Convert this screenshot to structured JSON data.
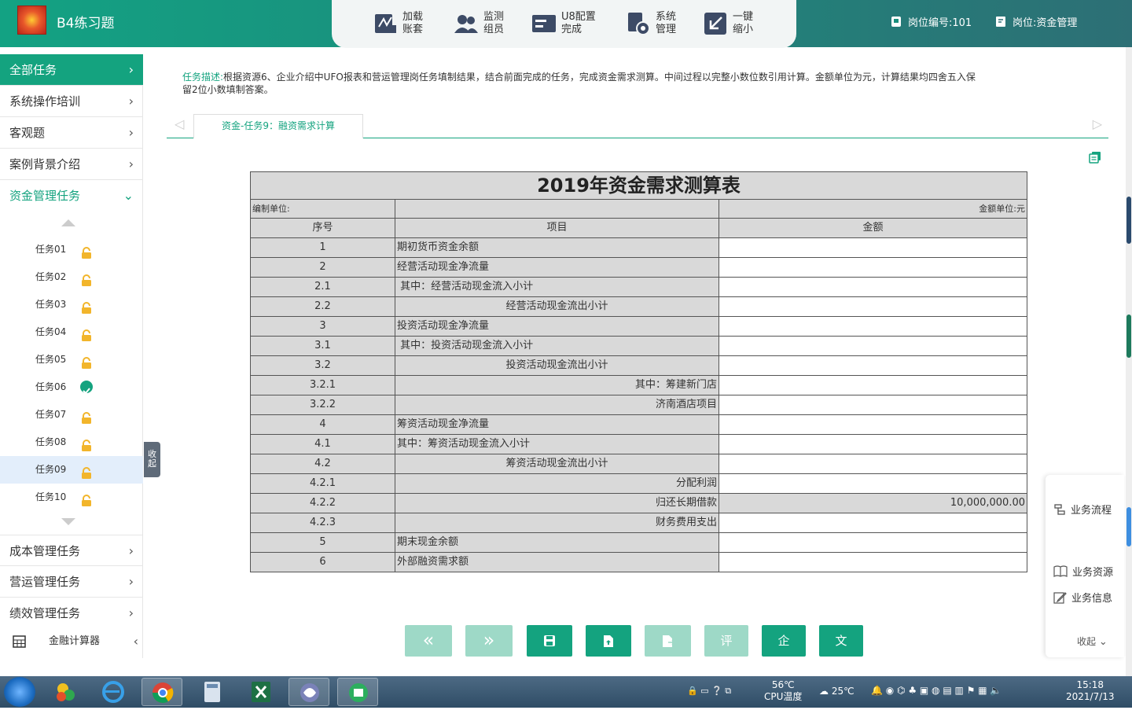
{
  "app": {
    "title": "B4练习题"
  },
  "toolbar": [
    {
      "label": "加载\n账套",
      "icon": "load-account-icon"
    },
    {
      "label": "监测\n组员",
      "icon": "monitor-members-icon"
    },
    {
      "label": "U8配置\n完成",
      "icon": "u8-config-icon"
    },
    {
      "label": "系统\n管理",
      "icon": "system-manage-icon"
    },
    {
      "label": "一键\n缩小",
      "icon": "minimize-icon"
    }
  ],
  "header": {
    "position_no": "岗位编号:101",
    "position_name": "岗位:资金管理"
  },
  "sidebar": {
    "menu": [
      {
        "label": "全部任务"
      },
      {
        "label": "系统操作培训"
      },
      {
        "label": "客观题"
      },
      {
        "label": "案例背景介绍"
      },
      {
        "label": "资金管理任务"
      }
    ],
    "tasks": [
      {
        "label": "任务01",
        "status": "locked"
      },
      {
        "label": "任务02",
        "status": "locked"
      },
      {
        "label": "任务03",
        "status": "locked"
      },
      {
        "label": "任务04",
        "status": "locked"
      },
      {
        "label": "任务05",
        "status": "locked"
      },
      {
        "label": "任务06",
        "status": "done"
      },
      {
        "label": "任务07",
        "status": "locked"
      },
      {
        "label": "任务08",
        "status": "locked"
      },
      {
        "label": "任务09",
        "status": "locked"
      },
      {
        "label": "任务10",
        "status": "locked"
      }
    ],
    "menu_bottom": [
      {
        "label": "成本管理任务"
      },
      {
        "label": "营运管理任务"
      },
      {
        "label": "绩效管理任务"
      }
    ],
    "calculator": "金融计算器",
    "collapse": "收起"
  },
  "task": {
    "desc_label": "任务描述:",
    "desc_text": "根据资源6、企业介绍中UFO报表和营运管理岗任务填制结果，结合前面完成的任务，完成资金需求测算。中间过程以完整小数位数引用计算。金额单位为元，计算结果均四舍五入保留2位小数填制答案。",
    "tab": "资金-任务9：融资需求计算"
  },
  "sheet": {
    "title": "2019年资金需求测算表",
    "unit_left": "编制单位:",
    "unit_right": "金额单位:元",
    "headers": [
      "序号",
      "项目",
      "金额"
    ],
    "rows": [
      {
        "no": "1",
        "item": "期初货币资金余额",
        "amount": ""
      },
      {
        "no": "2",
        "item": "经营活动现金净流量",
        "amount": ""
      },
      {
        "no": "2.1",
        "item": " 其中：经营活动现金流入小计",
        "amount": ""
      },
      {
        "no": "2.2",
        "item": "经营活动现金流出小计",
        "amount": ""
      },
      {
        "no": "3",
        "item": "投资活动现金净流量",
        "amount": ""
      },
      {
        "no": "3.1",
        "item": " 其中：投资活动现金流入小计",
        "amount": ""
      },
      {
        "no": "3.2",
        "item": "投资活动现金流出小计",
        "amount": ""
      },
      {
        "no": "3.2.1",
        "item": "其中：筹建新门店",
        "amount": ""
      },
      {
        "no": "3.2.2",
        "item": "济南酒店项目",
        "amount": ""
      },
      {
        "no": "4",
        "item": "筹资活动现金净流量",
        "amount": ""
      },
      {
        "no": "4.1",
        "item": "其中：筹资活动现金流入小计",
        "amount": ""
      },
      {
        "no": "4.2",
        "item": "筹资活动现金流出小计",
        "amount": ""
      },
      {
        "no": "4.2.1",
        "item": "分配利润",
        "amount": ""
      },
      {
        "no": "4.2.2",
        "item": "归还长期借款",
        "amount": "10,000,000.00"
      },
      {
        "no": "4.2.3",
        "item": "财务费用支出",
        "amount": ""
      },
      {
        "no": "5",
        "item": "期末现金余额",
        "amount": ""
      },
      {
        "no": "6",
        "item": "外部融资需求额",
        "amount": ""
      }
    ]
  },
  "buttons": {
    "prev": "«",
    "next": "»",
    "eval": "评",
    "ent": "企",
    "text": "文"
  },
  "rightpanel": {
    "flow": "业务流程",
    "resource": "业务资源",
    "info": "业务信息",
    "collapse": "收起"
  },
  "taskbar": {
    "temp": "56℃",
    "cpu": "CPU温度",
    "weather": "25℃",
    "time": "15:18",
    "date": "2021/7/13"
  }
}
